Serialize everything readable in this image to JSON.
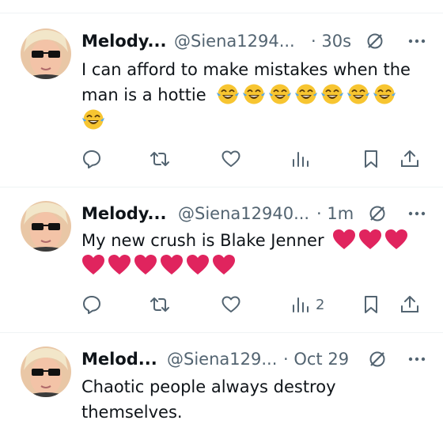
{
  "colors": {
    "text": "#0f1419",
    "secondary": "#536471",
    "divider": "#eff3f4",
    "heart": "#e0245e",
    "emoji": "#f7c531"
  },
  "tweets": [
    {
      "name": "Melody...",
      "handle": "@Siena1294...",
      "time": "· 30s",
      "text": "I can afford to make mistakes when the man is a hottie",
      "emoji": "laughing-crying-emoji",
      "emoji_count": 8,
      "views": ""
    },
    {
      "name": "Melody...",
      "handle": "@Siena12940...",
      "time": "· 1m",
      "text": "My new crush is Blake Jenner",
      "emoji": "red-heart-emoji",
      "emoji_count": 9,
      "views": "2"
    },
    {
      "name": "Melod...",
      "handle": "@Siena129...",
      "time": "· Oct 29",
      "text": "Chaotic people always destroy themselves.",
      "emoji": "",
      "emoji_count": 0,
      "views": ""
    }
  ],
  "icons": [
    "grok-icon",
    "more-icon",
    "reply-icon",
    "retweet-icon",
    "like-icon",
    "views-icon",
    "bookmark-icon",
    "share-icon"
  ]
}
